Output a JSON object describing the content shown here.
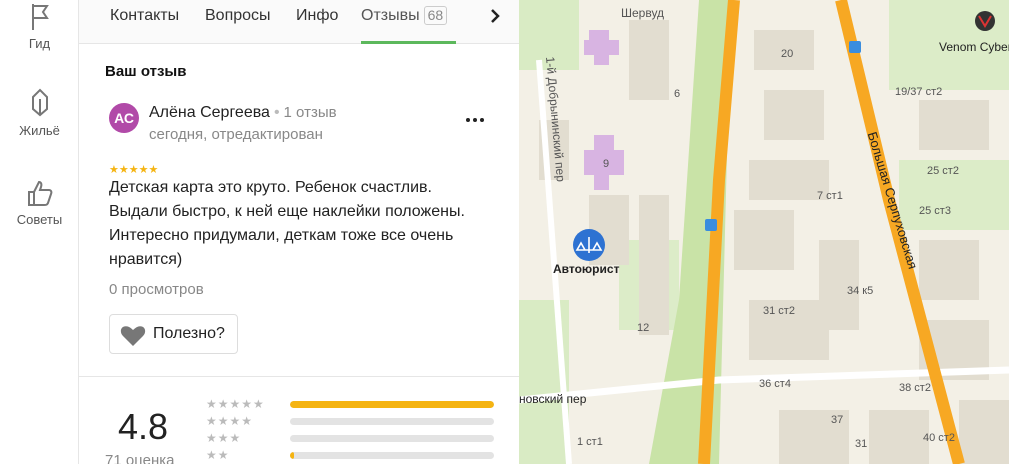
{
  "rail": {
    "items": [
      {
        "label": "Гид",
        "icon": "flag-icon"
      },
      {
        "label": "Жильё",
        "icon": "house-icon"
      },
      {
        "label": "Советы",
        "icon": "thumbs-up-icon"
      }
    ]
  },
  "tabs": {
    "items": [
      "Контакты",
      "Вопросы",
      "Инфо",
      "Отзывы"
    ],
    "reviews_count": "68",
    "active": "Отзывы"
  },
  "review": {
    "section_title": "Ваш отзыв",
    "avatar_initials": "АС",
    "author": "Алёна Сергеева",
    "author_reviews": "1 отзыв",
    "date": "сегодня, отредактирован",
    "stars": 5,
    "text": "Детская карта это круто. Ребенок счастлив. Выдали быстро, к ней еще наклейки положены. Интересно придумали, деткам тоже все очень нравится)",
    "views": "0 просмотров",
    "useful_label": "Полезно?"
  },
  "rating": {
    "value": "4.8",
    "count_label": "71 оценка",
    "distribution": [
      {
        "stars": 5,
        "fraction": 1.0
      },
      {
        "stars": 4,
        "fraction": 0.0
      },
      {
        "stars": 3,
        "fraction": 0.0
      },
      {
        "stars": 2,
        "fraction": 0.02
      }
    ]
  },
  "map": {
    "labels": {
      "sherwood": "Шервуд",
      "venom": "Venom Cyber",
      "dobryninsky": "1-й Добрынинский пер",
      "bolshaya": "Большая Серпуховская",
      "autolawyer": "Автоюрист",
      "lane_bottom": "новский пер",
      "n20": "20",
      "n19_37": "19/37 ст2",
      "n25_2": "25 ст2",
      "n25_3": "25 ст3",
      "n7_1": "7 ст1",
      "n34_5": "34 к5",
      "n31_2": "31 ст2",
      "n36_4": "36 ст4",
      "n38_2": "38 ст2",
      "n40_2": "40 ст2",
      "n37": "37",
      "n12": "12",
      "n9": "9",
      "n6": "6",
      "n1_1": "1 ст1",
      "n31": "31"
    },
    "colors": {
      "road": "#f7a823",
      "park": "#c9e3a7",
      "buildings": "#e2ddd0",
      "purple": "#d8b4e2"
    }
  }
}
